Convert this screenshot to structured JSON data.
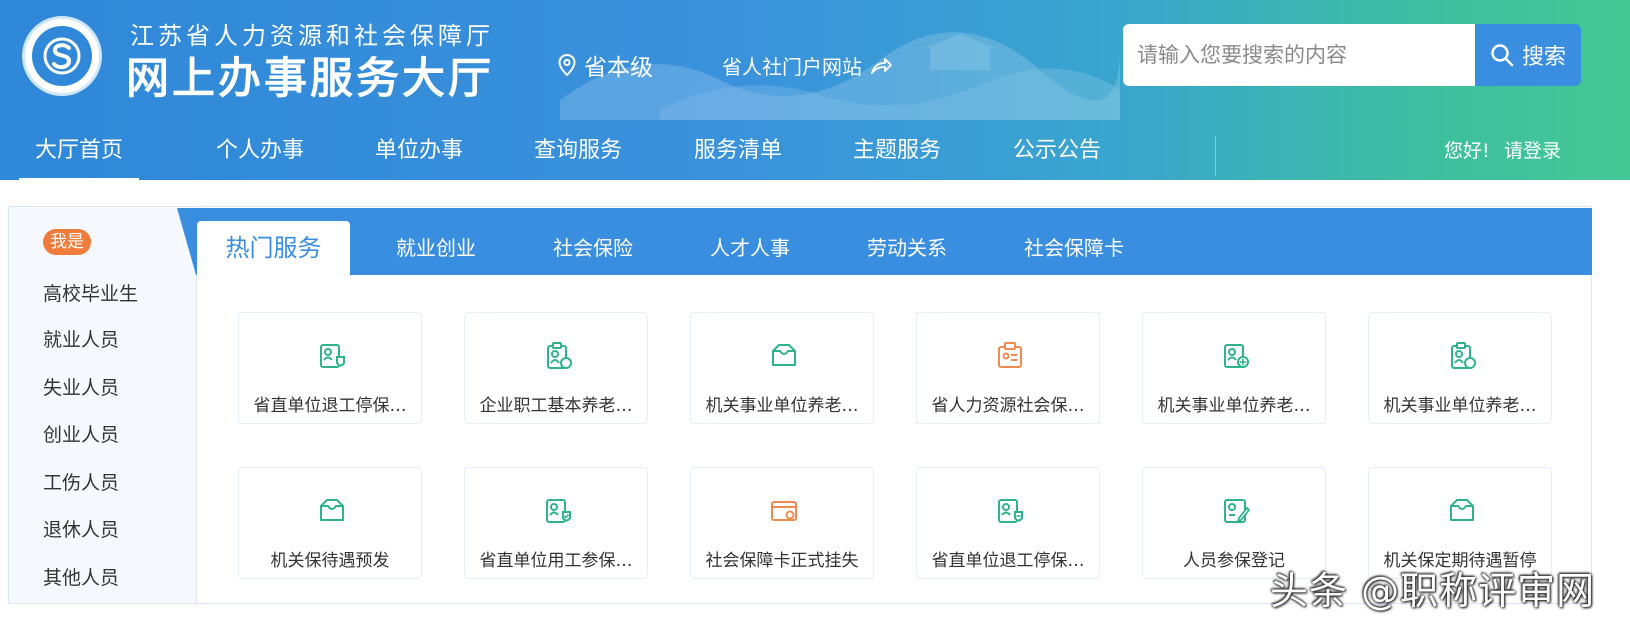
{
  "header": {
    "org_name": "江苏省人力资源和社会保障厅",
    "portal_name": "网上办事服务大厅",
    "region_label": "省本级",
    "portal_link": "省人社门户网站",
    "search_placeholder": "请输入您要搜索的内容",
    "search_button": "搜索"
  },
  "nav": {
    "items": [
      "大厅首页",
      "个人办事",
      "单位办事",
      "查询服务",
      "服务清单",
      "主题服务",
      "公示公告"
    ],
    "active_index": 0,
    "greeting": "您好!",
    "login": "请登录"
  },
  "sidebar": {
    "badge": "我是",
    "items": [
      "高校毕业生",
      "就业人员",
      "失业人员",
      "创业人员",
      "工伤人员",
      "退休人员",
      "其他人员"
    ]
  },
  "tabs": {
    "active": "热门服务",
    "items": [
      "就业创业",
      "社会保险",
      "人才人事",
      "劳动关系",
      "社会保障卡"
    ]
  },
  "services": [
    {
      "label": "省直单位退工停保…",
      "icon": "person-doc-shield-icon",
      "color": "#2fb38f"
    },
    {
      "label": "企业职工基本养老…",
      "icon": "clipboard-person-icon",
      "color": "#2fb38f"
    },
    {
      "label": "机关事业单位养老…",
      "icon": "inbox-tray-icon",
      "color": "#2fb38f"
    },
    {
      "label": "省人力资源社会保…",
      "icon": "clipboard-list-icon",
      "color": "#f08a50"
    },
    {
      "label": "机关事业单位养老…",
      "icon": "person-doc-plus-icon",
      "color": "#2fb38f"
    },
    {
      "label": "机关事业单位养老…",
      "icon": "clipboard-person-icon",
      "color": "#2fb38f"
    },
    {
      "label": "机关保待遇预发",
      "icon": "inbox-tray-icon",
      "color": "#2fb38f"
    },
    {
      "label": "省直单位用工参保…",
      "icon": "person-doc-check-icon",
      "color": "#2fb38f"
    },
    {
      "label": "社会保障卡正式挂失",
      "icon": "card-icon",
      "color": "#f08a50"
    },
    {
      "label": "省直单位退工停保…",
      "icon": "person-doc-minus-icon",
      "color": "#2fb38f"
    },
    {
      "label": "人员参保登记",
      "icon": "doc-pen-icon",
      "color": "#2fb38f"
    },
    {
      "label": "机关保定期待遇暂停",
      "icon": "inbox-tray-icon",
      "color": "#2fb38f"
    }
  ],
  "watermark": "头条 @职称评审网"
}
